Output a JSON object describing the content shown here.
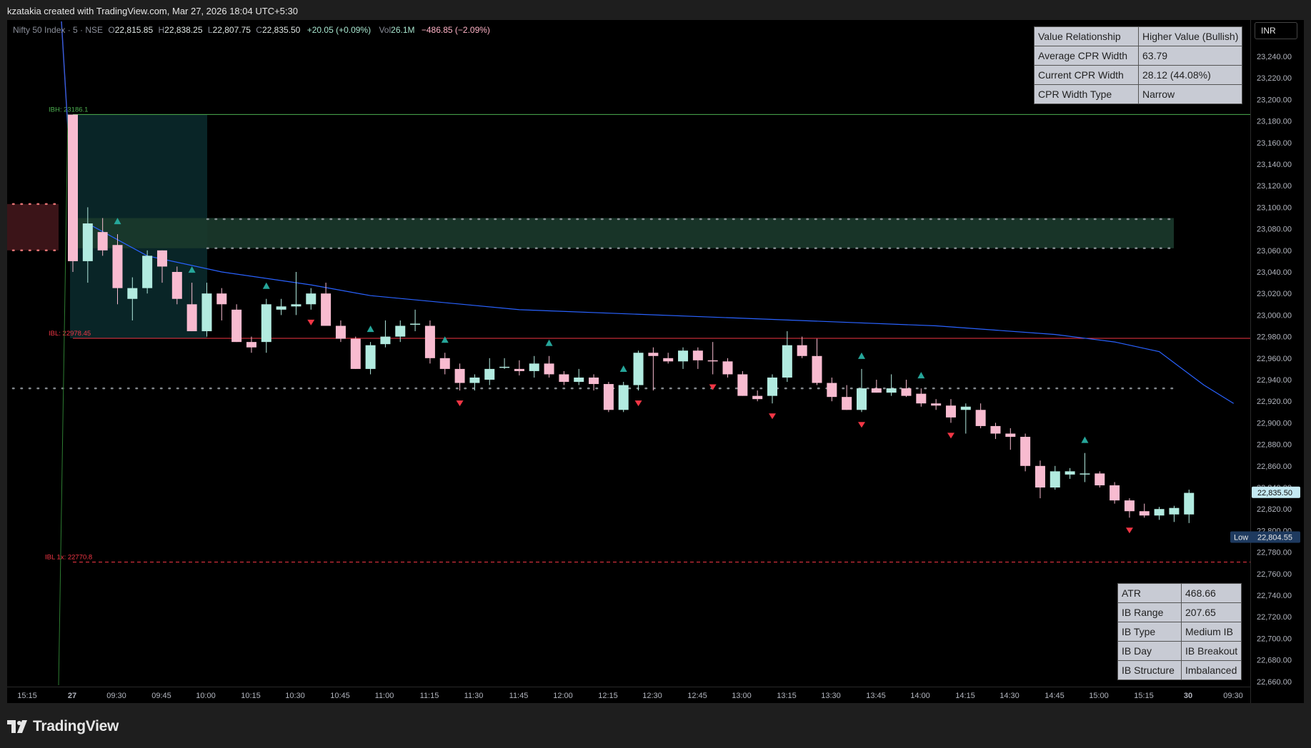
{
  "header": {
    "credit": "kzatakia created with TradingView.com, Mar 27, 2026 18:04 UTC+5:30"
  },
  "legend": {
    "symbol": "Nifty 50 Index · 5 · NSE",
    "o_label": "O",
    "o": "22,815.85",
    "h_label": "H",
    "h": "22,838.25",
    "l_label": "L",
    "l": "22,807.75",
    "c_label": "C",
    "c": "22,835.50",
    "change": "+20.05 (+0.09%)",
    "vol_label": "Vol",
    "vol": "26.1M",
    "day_change": "−486.85 (−2.09%)"
  },
  "currency": "INR",
  "brand": "TradingView",
  "cpr_table": [
    {
      "label": "Value Relationship",
      "value": "Higher Value (Bullish)"
    },
    {
      "label": "Average CPR Width",
      "value": "63.79"
    },
    {
      "label": "Current CPR Width",
      "value": "28.12 (44.08%)"
    },
    {
      "label": "CPR Width Type",
      "value": "Narrow"
    }
  ],
  "ib_table": [
    {
      "label": "ATR",
      "value": "468.66"
    },
    {
      "label": "IB Range",
      "value": "207.65"
    },
    {
      "label": "IB Type",
      "value": "Medium IB"
    },
    {
      "label": "IB Day",
      "value": "IB Breakout"
    },
    {
      "label": "IB Structure",
      "value": "Imbalanced"
    }
  ],
  "colors": {
    "up": "#b2ebe0",
    "down": "#f8bbd0",
    "buy_marker": "#26a69a",
    "sell_marker": "#f23645",
    "vwap": "#2962ff",
    "ibh": "#4caf50",
    "ibl": "#f23645",
    "cpr_zone": "#1b3a2c",
    "prev_zone": "#3b1418"
  },
  "chart_data": {
    "type": "candlestick",
    "title": "Nifty 50 Index · 5 · NSE",
    "ylim": [
      22660,
      23250
    ],
    "y_ticks": [
      22660,
      22680,
      22700,
      22720,
      22740,
      22760,
      22780,
      22800,
      22820,
      22840,
      22860,
      22880,
      22900,
      22920,
      22940,
      22960,
      22980,
      23000,
      23020,
      23040,
      23060,
      23080,
      23100,
      23120,
      23140,
      23160,
      23180,
      23200,
      23220,
      23240
    ],
    "x_ticks": [
      "15:15",
      "27",
      "09:30",
      "09:45",
      "10:00",
      "10:15",
      "10:30",
      "10:45",
      "11:00",
      "11:15",
      "11:30",
      "11:45",
      "12:00",
      "12:15",
      "12:30",
      "12:45",
      "13:00",
      "13:15",
      "13:30",
      "13:45",
      "14:00",
      "14:15",
      "14:30",
      "14:45",
      "15:00",
      "15:15",
      "30",
      "09:30"
    ],
    "last_price": "22,835.50",
    "low_label": "Low",
    "low_price": "22,804.55",
    "levels": [
      {
        "name": "IBH",
        "label": "IBH: 23186.1",
        "value": 23186.1
      },
      {
        "name": "IBL",
        "label": "IBL: 22978.45",
        "value": 22978.45
      },
      {
        "name": "IBL 1x",
        "label": "IBL 1x: 22770.8",
        "value": 22770.8
      }
    ],
    "candles": [
      [
        23186,
        23186,
        23040,
        23050
      ],
      [
        23050,
        23100,
        23030,
        23085
      ],
      [
        23077,
        23090,
        23055,
        23060
      ],
      [
        23065,
        23075,
        23010,
        23025
      ],
      [
        23015,
        23035,
        22995,
        23025
      ],
      [
        23025,
        23060,
        23020,
        23055
      ],
      [
        23060,
        23060,
        23030,
        23045
      ],
      [
        23040,
        23045,
        23010,
        23015
      ],
      [
        23010,
        23030,
        22985,
        22985
      ],
      [
        22985,
        23030,
        22980,
        23020
      ],
      [
        23020,
        23025,
        22995,
        23010
      ],
      [
        23005,
        23010,
        22975,
        22975
      ],
      [
        22975,
        22980,
        22965,
        22970
      ],
      [
        22975,
        23015,
        22965,
        23010
      ],
      [
        23005,
        23015,
        23000,
        23008
      ],
      [
        23008,
        23040,
        23000,
        23010
      ],
      [
        23010,
        23025,
        23005,
        23020
      ],
      [
        23020,
        23030,
        22990,
        22990
      ],
      [
        22990,
        22995,
        22975,
        22978
      ],
      [
        22978,
        22980,
        22950,
        22950
      ],
      [
        22950,
        22975,
        22945,
        22972
      ],
      [
        22973,
        22995,
        22970,
        22980
      ],
      [
        22980,
        22995,
        22975,
        22990
      ],
      [
        22991,
        23005,
        22985,
        22992
      ],
      [
        22990,
        22995,
        22955,
        22960
      ],
      [
        22960,
        22965,
        22945,
        22950
      ],
      [
        22950,
        22955,
        22930,
        22937
      ],
      [
        22937,
        22945,
        22930,
        22942
      ],
      [
        22940,
        22960,
        22935,
        22950
      ],
      [
        22952,
        22960,
        22950,
        22952
      ],
      [
        22950,
        22958,
        22944,
        22948
      ],
      [
        22948,
        22962,
        22942,
        22955
      ],
      [
        22955,
        22962,
        22942,
        22945
      ],
      [
        22945,
        22948,
        22935,
        22938
      ],
      [
        22938,
        22950,
        22935,
        22942
      ],
      [
        22942,
        22945,
        22930,
        22936
      ],
      [
        22936,
        22938,
        22910,
        22912
      ],
      [
        22912,
        22938,
        22910,
        22935
      ],
      [
        22935,
        22967,
        22930,
        22965
      ],
      [
        22965,
        22970,
        22930,
        22962
      ],
      [
        22960,
        22965,
        22955,
        22957
      ],
      [
        22957,
        22970,
        22950,
        22967
      ],
      [
        22967,
        22970,
        22950,
        22958
      ],
      [
        22958,
        22975,
        22945,
        22957
      ],
      [
        22957,
        22960,
        22942,
        22945
      ],
      [
        22945,
        22948,
        22925,
        22925
      ],
      [
        22925,
        22930,
        22920,
        22922
      ],
      [
        22925,
        22945,
        22918,
        22942
      ],
      [
        22942,
        22985,
        22938,
        22972
      ],
      [
        22972,
        22980,
        22960,
        22962
      ],
      [
        22962,
        22978,
        22935,
        22937
      ],
      [
        22937,
        22942,
        22920,
        22924
      ],
      [
        22924,
        22935,
        22912,
        22912
      ],
      [
        22912,
        22950,
        22910,
        22932
      ],
      [
        22932,
        22940,
        22928,
        22928
      ],
      [
        22928,
        22945,
        22925,
        22932
      ],
      [
        22932,
        22940,
        22924,
        22925
      ],
      [
        22927,
        22932,
        22915,
        22918
      ],
      [
        22918,
        22922,
        22912,
        22916
      ],
      [
        22916,
        22922,
        22900,
        22905
      ],
      [
        22912,
        22918,
        22890,
        22915
      ],
      [
        22912,
        22918,
        22895,
        22897
      ],
      [
        22897,
        22900,
        22885,
        22890
      ],
      [
        22890,
        22895,
        22875,
        22887
      ],
      [
        22887,
        22890,
        22855,
        22860
      ],
      [
        22860,
        22865,
        22830,
        22840
      ],
      [
        22840,
        22860,
        22838,
        22855
      ],
      [
        22852,
        22858,
        22848,
        22855
      ],
      [
        22853,
        22872,
        22845,
        22853
      ],
      [
        22853,
        22855,
        22840,
        22842
      ],
      [
        22842,
        22845,
        22825,
        22828
      ],
      [
        22828,
        22830,
        22812,
        22818
      ],
      [
        22818,
        22825,
        22812,
        22814
      ],
      [
        22814,
        22822,
        22810,
        22820
      ],
      [
        22815,
        22823,
        22808,
        22821
      ],
      [
        22815,
        22838,
        22807,
        22835
      ]
    ],
    "buy_markers": [
      16,
      26,
      38,
      43,
      47,
      53,
      59,
      71
    ],
    "sell_markers": [
      3,
      8,
      13,
      20,
      25,
      32,
      37,
      53,
      57,
      68
    ],
    "vwap": [
      [
        1,
        23085
      ],
      [
        5,
        23055
      ],
      [
        10,
        23040
      ],
      [
        16,
        23028
      ],
      [
        20,
        23018
      ],
      [
        30,
        23005
      ],
      [
        45,
        22997
      ],
      [
        58,
        22990
      ],
      [
        66,
        22982
      ],
      [
        70,
        22975
      ],
      [
        73,
        22966
      ],
      [
        76,
        22935
      ],
      [
        78,
        22918
      ]
    ],
    "cpr_zone": {
      "top": 23090,
      "bottom": 23062
    },
    "prev_zone": {
      "top": 23103,
      "bottom": 23060
    },
    "dotted_levels": [
      23089,
      23062,
      22932
    ]
  }
}
